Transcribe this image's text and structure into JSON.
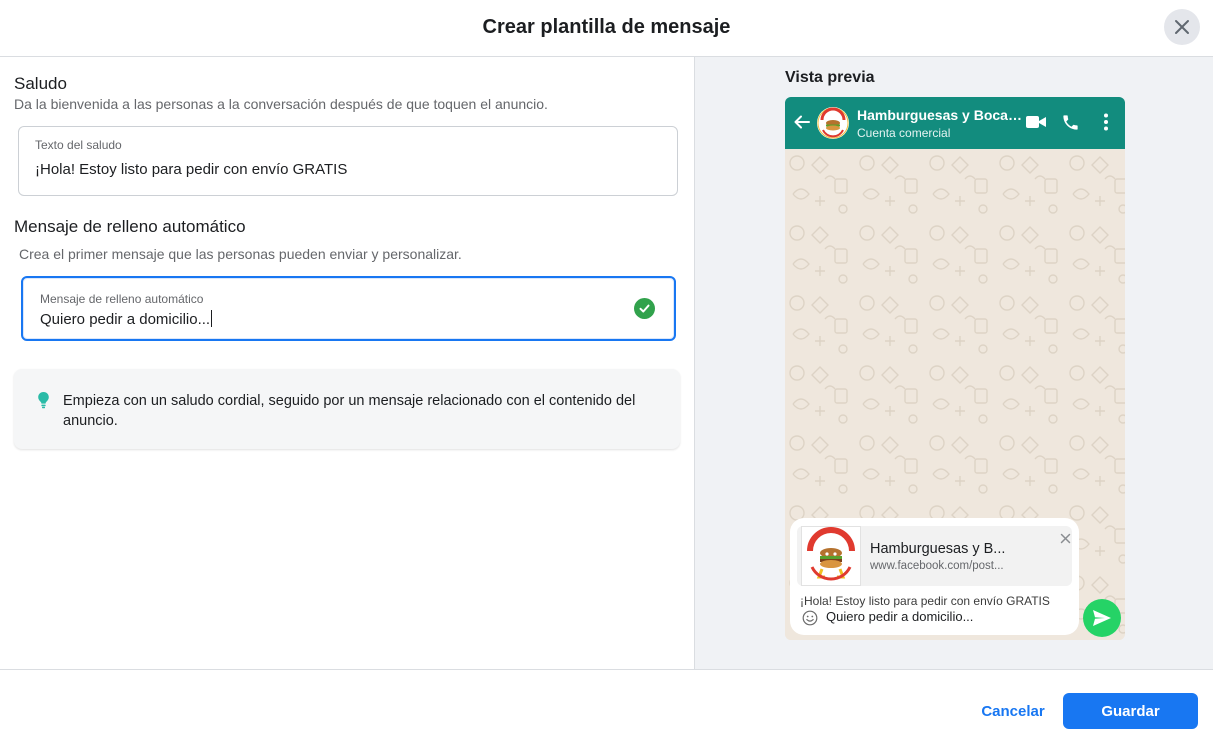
{
  "dialog": {
    "title": "Crear plantilla de mensaje"
  },
  "greeting": {
    "title": "Saludo",
    "description": "Da la bienvenida a las personas a la conversación después de que toquen el anuncio.",
    "field_label": "Texto del saludo",
    "field_value": "¡Hola! Estoy listo para pedir con envío GRATIS"
  },
  "autofill": {
    "title": "Mensaje de relleno automático",
    "description": "Crea el primer mensaje que las personas pueden enviar y personalizar.",
    "field_label": "Mensaje de relleno automático",
    "field_value": "Quiero pedir a domicilio...",
    "status": "valid"
  },
  "tip": {
    "text": "Empieza con un saludo cordial, seguido por un mensaje relacionado con el contenido del anuncio.",
    "icon": "lightbulb-icon"
  },
  "preview": {
    "title": "Vista previa",
    "whatsapp": {
      "business_name": "Hamburguesas y Bocadillos",
      "business_type": "Cuenta comercial",
      "header_color": "#128c7e",
      "link_title": "Hamburguesas y B...",
      "link_url": "www.facebook.com/post...",
      "greeting_text": "¡Hola! Estoy listo para pedir con envío GRATIS",
      "message_text": "Quiero pedir a domicilio...",
      "send_color": "#25d366"
    }
  },
  "footer": {
    "cancel_label": "Cancelar",
    "save_label": "Guardar"
  },
  "colors": {
    "accent": "#1877f2",
    "success": "#31a24c",
    "tip_icon": "#2abba7"
  }
}
